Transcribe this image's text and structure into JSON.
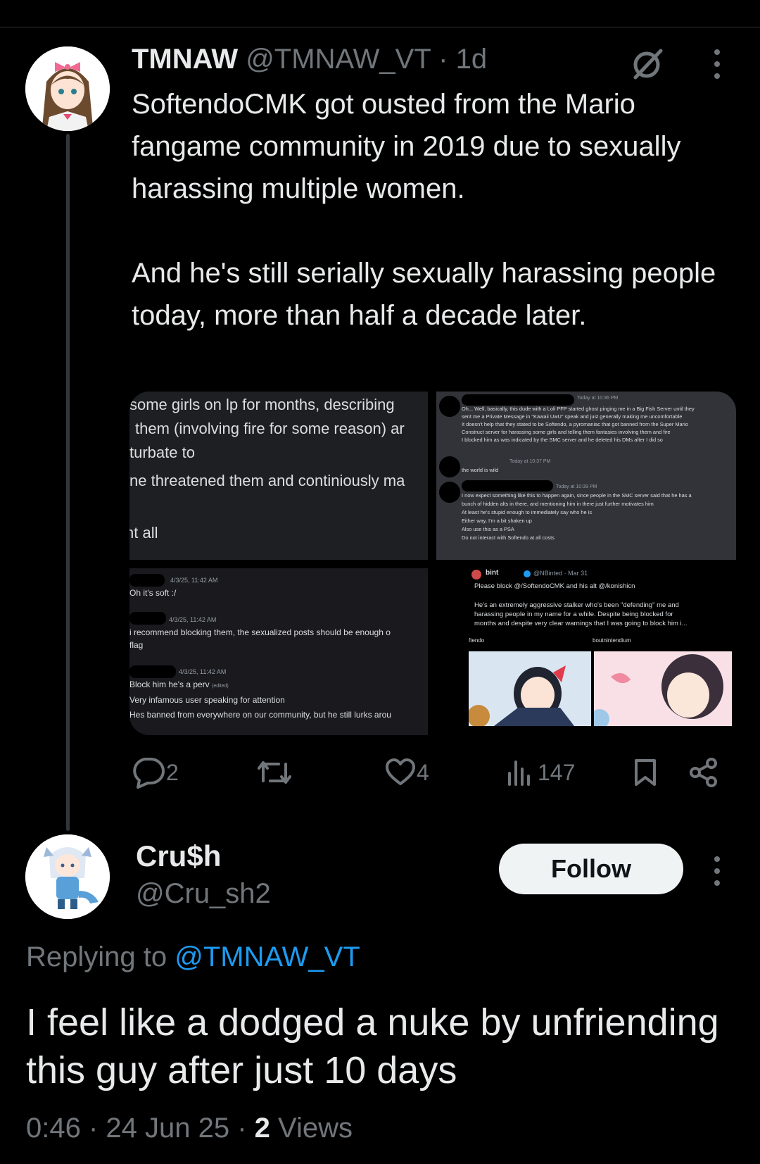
{
  "tweet": {
    "author_name": "TMNAW",
    "handle": "@TMNAW_VT",
    "time": "· 1d",
    "text": "SoftendoCMK got ousted from the Mario fangame community in 2019 due to sexually harassing multiple women.\n\nAnd he's still serially sexually harassing people today, more than half a decade later.",
    "icons": {
      "grok": "grok-slash-icon",
      "more": "more-vertical-icon"
    },
    "images": {
      "img1": {
        "lines": [
          "some girls on lp for months, describing",
          "them (involving fire for some reason) ar",
          "turbate to",
          "ne threatened them and continiously ma",
          "nt all"
        ]
      },
      "img2": {
        "ts1": "Today at 10:36 PM",
        "msg1": [
          "Oh... Well, basically, this dude with a Loli PFP started ghost pinging me in a Big Fish Server until they",
          "sent me a Private Message in \"Kawaii UwU\" speak and just generally making me uncomfortable",
          "It doesn't help that they stated to be Softendo, a pyromaniac that got banned from the Super Mario",
          "Construct server for harassing some girls and telling them fantasies involving them and fire",
          "I blocked him as was indicated by the SMC server and he deleted his DMs after I did so"
        ],
        "ts2": "Today at 10:37 PM",
        "msg2": [
          "the world is wild"
        ],
        "ts3": "Today at 10:39 PM",
        "msg3": [
          "I now expect something like this to happen again, since people in the SMC server said that he has a",
          "bunch of hidden alts in there, and mentioning him in there just further motivates him",
          "At least he's stupid enough to immediately say who he is",
          "Either way, I'm a bit shaken up",
          "Also use this as a PSA",
          "Do not interact with Softendo at all costs"
        ]
      },
      "img3": {
        "ts1": "4/3/25, 11:42 AM",
        "msg1": "Oh it's soft :/",
        "ts2": "4/3/25, 11:42 AM",
        "msg2a": "i recommend blocking them, the sexualized posts should be enough o",
        "msg2b": "flag",
        "ts3": "4/3/25, 11:42 AM",
        "msg3a": "Block him he's a perv",
        "edited": "(edited)",
        "msg3b": "Very infamous user speaking for attention",
        "msg3c": "Hes banned from everywhere on our community, but he still lurks arou"
      },
      "img4": {
        "name": "bint",
        "handle": "@NBinted · Mar 31",
        "line1": "Please block @/SoftendoCMK and his alt @/konishicn",
        "line2": "He's an extremely aggressive stalker who's been \"defending\" me and",
        "line3": "harassing people in my name for a while. Despite being blocked for",
        "line4": "months and despite very clear warnings that I was going to block him i...",
        "left_label": "ftendo",
        "right_label": "boutnintendium"
      }
    },
    "stats": {
      "replies": "2",
      "retweets": "",
      "likes": "4",
      "views": "147"
    }
  },
  "reply": {
    "name": "Cru$h",
    "handle": "@Cru_sh2",
    "follow_label": "Follow",
    "replying_prefix": "Replying to ",
    "replying_handle": "@TMNAW_VT",
    "text": "I feel like a dodged a nuke by unfriending this guy after just 10 days",
    "time": "0:46 · 24 Jun 25 · ",
    "views_count": "2",
    "views_label": " Views"
  },
  "colors": {
    "background": "#000000",
    "text": "#e7e9ea",
    "muted": "#71767b",
    "link": "#1d9bf0"
  }
}
